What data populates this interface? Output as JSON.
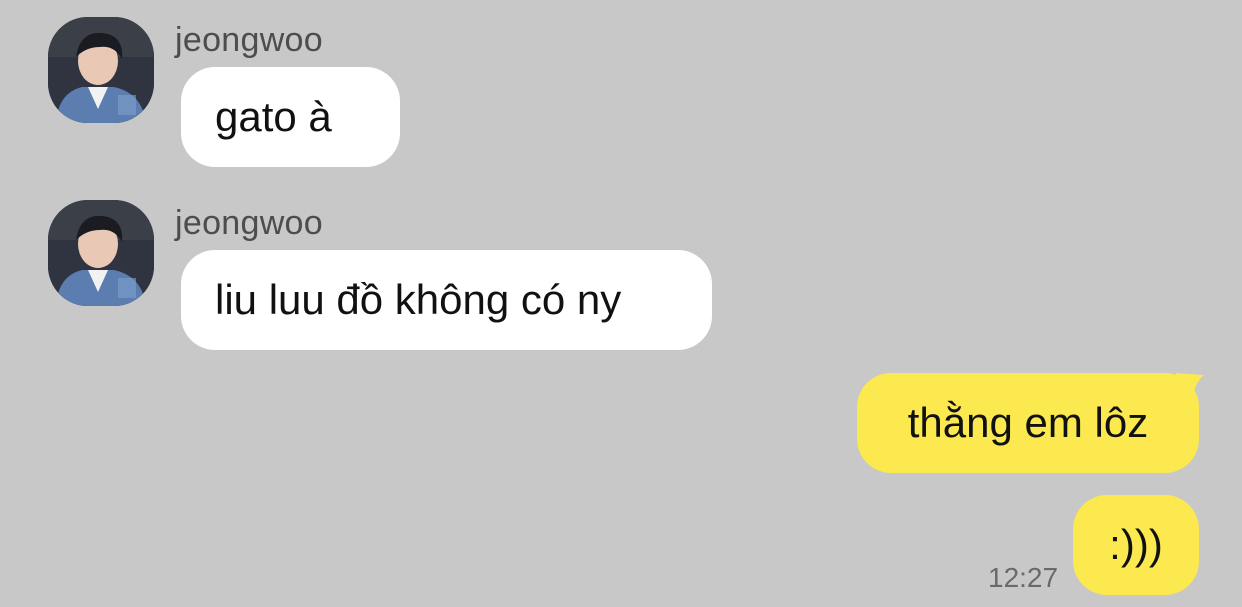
{
  "messages": [
    {
      "sender": "jeongwoo",
      "text": "gato à",
      "direction": "incoming"
    },
    {
      "sender": "jeongwoo",
      "text": "liu luu đồ không có ny",
      "direction": "incoming"
    },
    {
      "text": "thằng em lôz",
      "direction": "outgoing"
    },
    {
      "text": ":)))",
      "direction": "outgoing",
      "time": "12:27"
    }
  ],
  "colors": {
    "background": "#c8c8c8",
    "incoming_bubble": "#ffffff",
    "outgoing_bubble": "#fbe94f"
  },
  "icons": [
    "avatar-photo"
  ]
}
